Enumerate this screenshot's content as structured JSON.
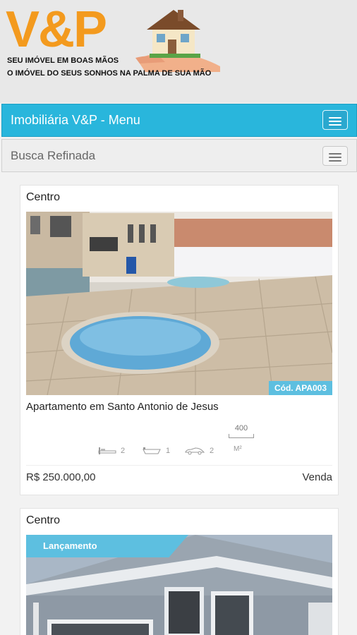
{
  "header": {
    "logo": "V&P",
    "tagline1": "SEU IMÓVEL EM BOAS MÃOS",
    "tagline2": "O IMÓVEL DO SEUS SONHOS NA PALMA DE SUA MÃO"
  },
  "nav": {
    "title": "Imobiliária V&P - Menu",
    "icon": "hamburger-menu-icon"
  },
  "refine": {
    "title": "Busca Refinada",
    "icon": "hamburger-menu-icon"
  },
  "listings": [
    {
      "location": "Centro",
      "code": "Cód. APA003",
      "title": "Apartamento em Santo Antonio de Jesus",
      "bedrooms": "2",
      "bathrooms": "1",
      "garages": "2",
      "area": "400",
      "area_unit": "M²",
      "price": "R$ 250.000,00",
      "deal": "Venda"
    },
    {
      "location": "Centro",
      "badge": "Lançamento"
    }
  ],
  "colors": {
    "accent": "#29b6dc",
    "brand": "#f39a1e",
    "badge": "#5dbfe0"
  }
}
